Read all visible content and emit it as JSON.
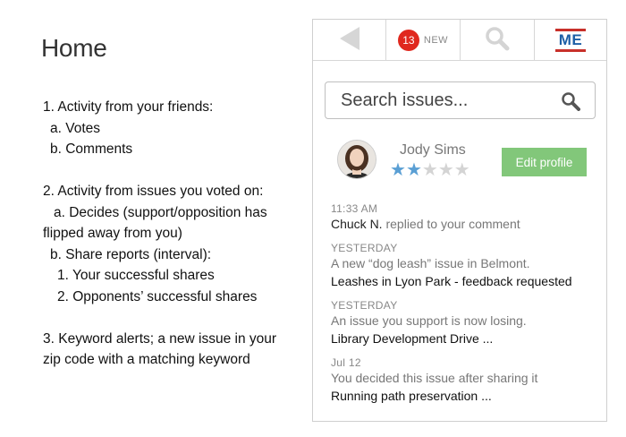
{
  "page": {
    "title": "Home"
  },
  "notes": {
    "lines": [
      "1. Activity from your friends:",
      "a. Votes",
      "b. Comments",
      "2. Activity from issues you voted on:",
      "a. Decides (support/opposition has flipped away from you)",
      "b. Share reports (interval):",
      "1. Your successful shares",
      "2. Opponents’ successful shares",
      "3. Keyword alerts; a new issue in your zip code with a matching keyword"
    ]
  },
  "nav": {
    "back_icon": "back-arrow-icon",
    "badge_count": "13",
    "new_label": "NEW",
    "search_icon": "magnifier-icon",
    "logo_text": "ME",
    "colors": {
      "badge": "#e0281e",
      "logo_text": "#1d5fa6",
      "logo_bar": "#c8302a"
    }
  },
  "search": {
    "placeholder": "Search issues..."
  },
  "profile": {
    "name": "Jody Sims",
    "rating": 2,
    "rating_max": 5,
    "edit_label": "Edit profile",
    "colors": {
      "star_on": "#5a9fd4",
      "star_off": "#d4d4d4",
      "button": "#82c77a"
    }
  },
  "feed": [
    {
      "time": "11:33 AM",
      "who": "Chuck N.",
      "text": " replied to your comment",
      "title": ""
    },
    {
      "time": "YESTERDAY",
      "who": "",
      "text": "A new “dog leash” issue in Belmont.",
      "title": "Leashes in Lyon Park - feedback requested"
    },
    {
      "time": "YESTERDAY",
      "who": "",
      "text": "An issue you support is now losing.",
      "title": "Library Development Drive ..."
    },
    {
      "time": "Jul 12",
      "who": "",
      "text": "You decided this issue after sharing it",
      "title": "Running path preservation ..."
    }
  ]
}
